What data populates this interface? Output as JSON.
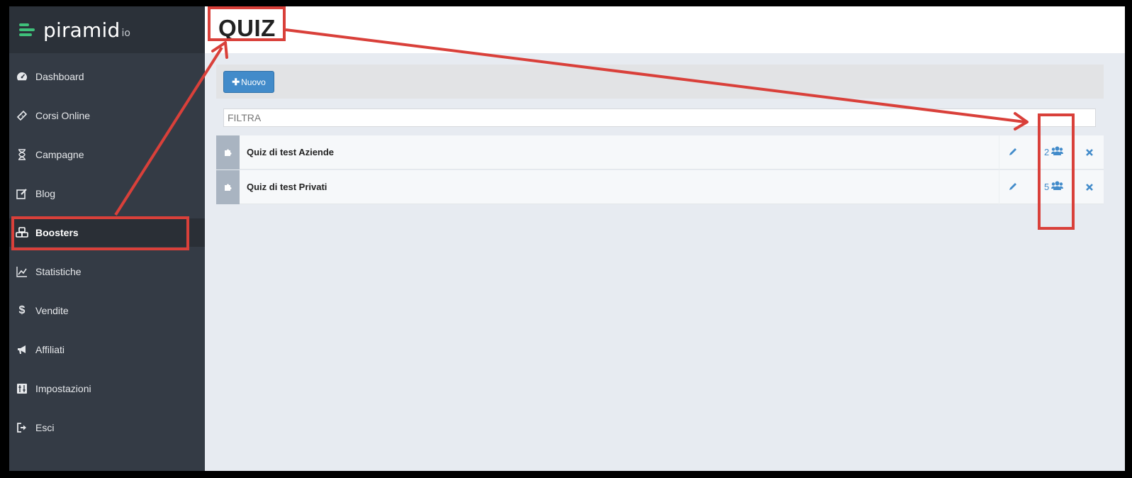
{
  "brand": {
    "name": "piramid",
    "suffix": "io",
    "accent": "#3fc07a"
  },
  "sidebar": {
    "items": [
      {
        "label": "Dashboard",
        "icon": "tachometer-icon"
      },
      {
        "label": "Corsi Online",
        "icon": "ticket-icon"
      },
      {
        "label": "Campagne",
        "icon": "hourglass-icon"
      },
      {
        "label": "Blog",
        "icon": "edit-icon"
      },
      {
        "label": "Boosters",
        "icon": "cubes-icon",
        "active": true
      },
      {
        "label": "Statistiche",
        "icon": "chart-line-icon"
      },
      {
        "label": "Vendite",
        "icon": "dollar-icon"
      },
      {
        "label": "Affiliati",
        "icon": "bullhorn-icon"
      },
      {
        "label": "Impostazioni",
        "icon": "sliders-icon"
      },
      {
        "label": "Esci",
        "icon": "sign-out-icon"
      }
    ]
  },
  "header": {
    "title": "QUIZ"
  },
  "toolbar": {
    "new_label": "Nuovo",
    "new_icon": "plus-icon"
  },
  "filter": {
    "placeholder": "FILTRA",
    "value": ""
  },
  "quizzes": [
    {
      "title": "Quiz di test Aziende",
      "users": "2"
    },
    {
      "title": "Quiz di test Privati",
      "users": "5"
    }
  ],
  "colors": {
    "sidebar": "#343b45",
    "primary": "#428bca",
    "annotation": "#d9403a"
  }
}
